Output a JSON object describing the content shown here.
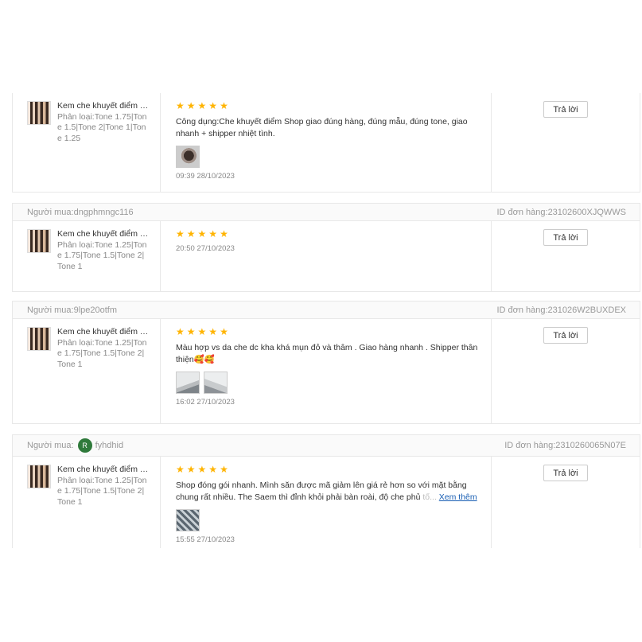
{
  "reply_label": "Trả lời",
  "buyer_prefix": "Người mua:",
  "order_prefix": "ID đơn hàng:",
  "see_more_label": "Xem thêm",
  "star_char": "★",
  "reviews": [
    {
      "product_name": "Kem che khuyết điểm The Saem Cover Perfection Tip Concealer",
      "variant": "Phân loại:Tone 1.75|Tone 1.5|Tone 2|Tone 1|Tone 1.25",
      "rating": 5,
      "text": "Công dụng:Che khuyết điểm Shop giao đúng hàng, đúng mẫu, đúng tone, giao nhanh + shipper nhiệt tình.",
      "time": "09:39 28/10/2023"
    },
    {
      "buyer": "dngphmngc116",
      "order_id": "23102600XJQWWS",
      "product_name": "Kem che khuyết điểm The Saem Cover Perfection Tip Concealer",
      "variant": "Phân loại:Tone 1.25|Tone 1.75|Tone 1.5|Tone 2|Tone 1",
      "rating": 5,
      "time": "20:50 27/10/2023"
    },
    {
      "buyer": "9lpe20otfm",
      "order_id": "231026W2BUXDEX",
      "product_name": "Kem che khuyết điểm The Saem Cover Perfection Tip Concealer",
      "variant": "Phân loại:Tone 1.25|Tone 1.75|Tone 1.5|Tone 2|Tone 1",
      "rating": 5,
      "text": "Màu hợp vs da che dc kha khá mụn đỏ và thâm . Giao hàng nhanh . Shipper thân thiện",
      "emoji": "🥰🥰",
      "time": "16:02 27/10/2023"
    },
    {
      "buyer": "fyhdhid",
      "buyer_avatar_letter": "R",
      "order_id": "2310260065N07E",
      "product_name": "Kem che khuyết điểm The Saem Cover Perfection Tip Concealer",
      "variant": "Phân loại:Tone 1.25|Tone 1.75|Tone 1.5|Tone 2|Tone 1",
      "rating": 5,
      "text": "Shop đóng gói nhanh. Mình săn được mã giảm lên giá rẻ hơn so với mặt bằng chung rất nhiều. The Saem thì đỉnh khỏi phải bàn roài, độ che phủ ",
      "text_fade": "tố...",
      "time": "15:55 27/10/2023"
    }
  ]
}
